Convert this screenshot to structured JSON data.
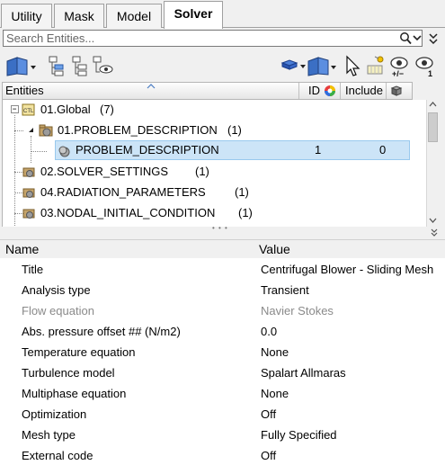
{
  "tabs": [
    {
      "label": "Utility"
    },
    {
      "label": "Mask"
    },
    {
      "label": "Model"
    },
    {
      "label": "Solver"
    }
  ],
  "active_tab": "Solver",
  "search": {
    "placeholder": "Search Entities..."
  },
  "entities_header": {
    "entities": "Entities",
    "id": "ID",
    "include": "Include"
  },
  "tree": [
    {
      "label": "01.Global",
      "count": "(7)",
      "id": "",
      "include": ""
    },
    {
      "label": "01.PROBLEM_DESCRIPTION",
      "count": "(1)",
      "id": "",
      "include": ""
    },
    {
      "label": "PROBLEM_DESCRIPTION",
      "count": "",
      "id": "1",
      "include": "0"
    },
    {
      "label": "02.SOLVER_SETTINGS",
      "count": "(1)",
      "id": "",
      "include": ""
    },
    {
      "label": "04.RADIATION_PARAMETERS",
      "count": "(1)",
      "id": "",
      "include": ""
    },
    {
      "label": "03.NODAL_INITIAL_CONDITION",
      "count": "(1)",
      "id": "",
      "include": ""
    }
  ],
  "splitter_grip": "• • •",
  "properties_header": {
    "name": "Name",
    "value": "Value"
  },
  "properties": [
    {
      "name": "Title",
      "value": "Centrifugal Blower - Sliding Mesh",
      "disabled": false
    },
    {
      "name": "Analysis type",
      "value": "Transient",
      "disabled": false
    },
    {
      "name": "Flow equation",
      "value": "Navier Stokes",
      "disabled": true
    },
    {
      "name": "Abs. pressure offset ## (N/m2)",
      "value": "0.0",
      "disabled": false
    },
    {
      "name": "Temperature equation",
      "value": "None",
      "disabled": false
    },
    {
      "name": "Turbulence model",
      "value": "Spalart Allmaras",
      "disabled": false
    },
    {
      "name": "Multiphase equation",
      "value": "None",
      "disabled": false
    },
    {
      "name": "Optimization",
      "value": "Off",
      "disabled": false
    },
    {
      "name": "Mesh type",
      "value": "Fully Specified",
      "disabled": false
    },
    {
      "name": "External code",
      "value": "Off",
      "disabled": false
    }
  ],
  "toolbar_icons": [
    "entity-view-icon",
    "show-selected-icon",
    "hide-selected-icon",
    "isolate-icon",
    "filter-icon",
    "entity-type-icon",
    "cursor-icon",
    "display-mode-icon",
    "reveal-toggle-icon",
    "show-only-icon"
  ],
  "colors": {
    "selection": "#cce4f7",
    "selection_border": "#99c9ee",
    "disabled_text": "#8a8a8a"
  }
}
